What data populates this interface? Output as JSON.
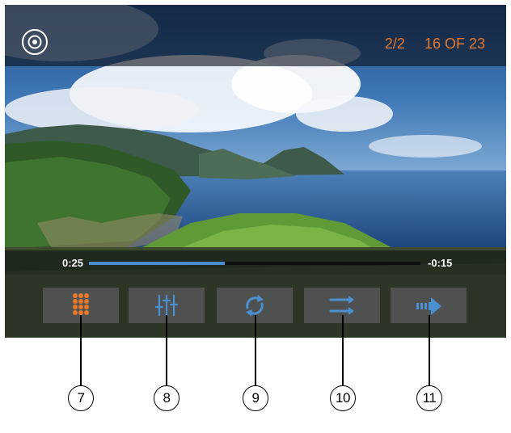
{
  "header": {
    "disc_icon": "disc-icon",
    "page_indicator": "2/2",
    "track_indicator": "16 OF 23",
    "accent_color": "#e8782a"
  },
  "playback": {
    "elapsed": "0:25",
    "remaining": "-0:15",
    "progress_percent": 41,
    "progress_color": "#4a8fd0"
  },
  "controls": [
    {
      "icon": "numeric-keypad-icon",
      "icon_color": "#e8782a"
    },
    {
      "icon": "equalizer-icon",
      "icon_color": "#4a8fd0"
    },
    {
      "icon": "repeat-icon",
      "icon_color": "#4a8fd0"
    },
    {
      "icon": "shuffle-icon",
      "icon_color": "#4a8fd0"
    },
    {
      "icon": "next-icon",
      "icon_color": "#4a8fd0"
    }
  ],
  "callouts": [
    "7",
    "8",
    "9",
    "10",
    "11"
  ]
}
